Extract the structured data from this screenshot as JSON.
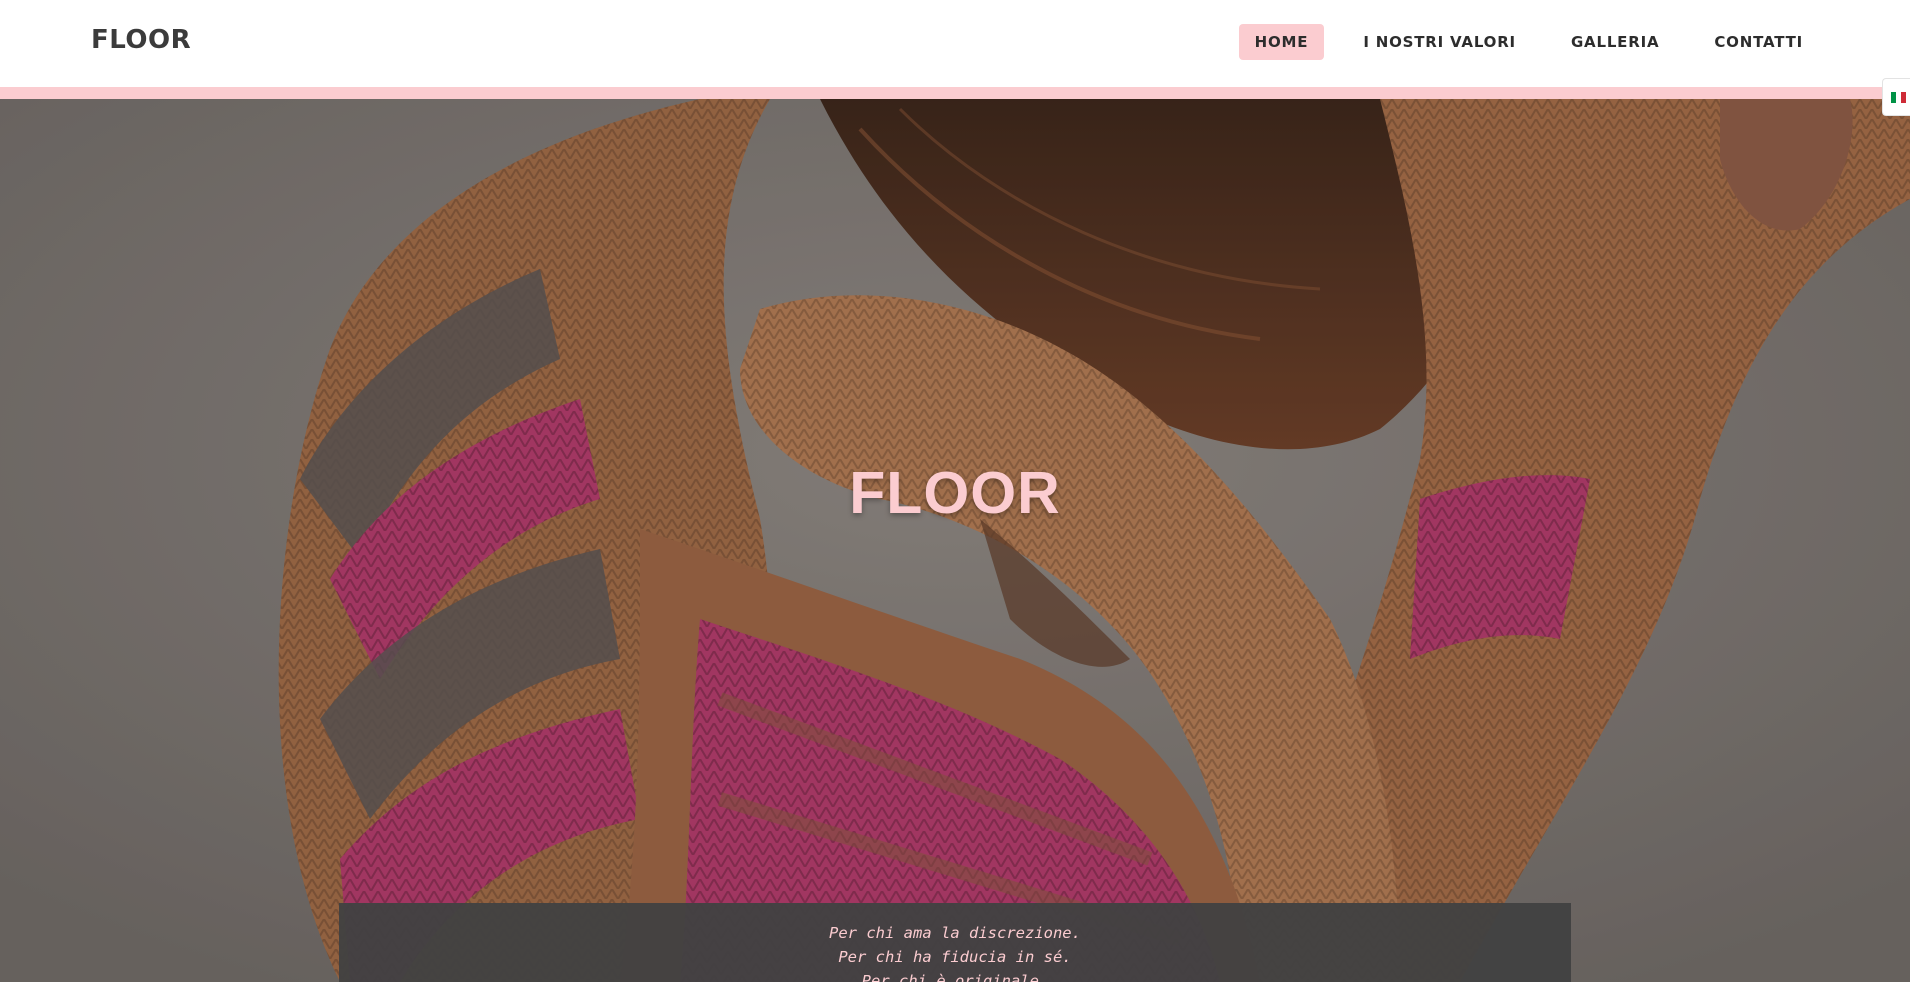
{
  "header": {
    "logo": "FLOOR",
    "nav": [
      {
        "label": "HOME",
        "active": true
      },
      {
        "label": "I NOSTRI VALORI",
        "active": false
      },
      {
        "label": "GALLERIA",
        "active": false
      },
      {
        "label": "CONTATTI",
        "active": false
      }
    ]
  },
  "language": {
    "icon": "italian-flag-icon"
  },
  "hero": {
    "title": "FLOOR",
    "image_description_icon": "knitwear-photo"
  },
  "tagline": {
    "lines": [
      "Per chi ama la discrezione.",
      "Per chi ha fiducia in sé.",
      "Per chi è originale."
    ]
  },
  "colors": {
    "accent": "#fbccd0",
    "text_dark": "#2d2d2d",
    "tagline_bg": "#424242"
  }
}
